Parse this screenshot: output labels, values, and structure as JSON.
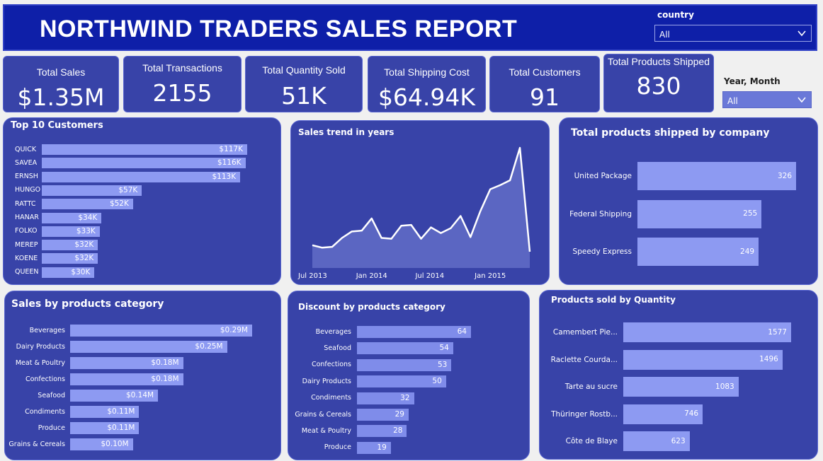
{
  "header": {
    "title": "NORTHWIND TRADERS SALES REPORT"
  },
  "slicers": {
    "country": {
      "label": "country",
      "value": "All"
    },
    "year_month": {
      "label": "Year, Month",
      "value": "All"
    }
  },
  "kpis": [
    {
      "label": "Total Sales",
      "value": "$1.35M"
    },
    {
      "label": "Total Transactions",
      "value": "2155"
    },
    {
      "label": "Total Quantity Sold",
      "value": "51K"
    },
    {
      "label": "Total Shipping Cost",
      "value": "$64.94K"
    },
    {
      "label": "Total Customers",
      "value": "91"
    },
    {
      "label": "Total Products Shipped",
      "value": "830"
    }
  ],
  "colors": {
    "panel": "#3843a8",
    "bar": "#8d9af2",
    "header": "#0e1fa8"
  },
  "chart_data": [
    {
      "type": "bar",
      "title": "Top 10 Customers",
      "categories": [
        "QUICK",
        "SAVEA",
        "ERNSH",
        "HUNGO",
        "RATTC",
        "HANAR",
        "FOLKO",
        "MEREP",
        "KOENE",
        "QUEEN"
      ],
      "values": [
        117,
        116,
        113,
        57,
        52,
        34,
        33,
        32,
        32,
        30
      ],
      "value_labels": [
        "$117K",
        "$116K",
        "$113K",
        "$57K",
        "$52K",
        "$34K",
        "$33K",
        "$32K",
        "$32K",
        "$30K"
      ]
    },
    {
      "type": "area",
      "title": "Sales trend in years",
      "x_ticks": [
        "Jul 2013",
        "Jan 2014",
        "Jul 2014",
        "Jan 2015"
      ],
      "x": [
        "2013-07",
        "2013-08",
        "2013-09",
        "2013-10",
        "2013-11",
        "2013-12",
        "2014-01",
        "2014-02",
        "2014-03",
        "2014-04",
        "2014-05",
        "2014-06",
        "2014-07",
        "2014-08",
        "2014-09",
        "2014-10",
        "2014-11",
        "2014-12",
        "2015-01",
        "2015-02",
        "2015-03",
        "2015-04",
        "2015-05"
      ],
      "values": [
        28,
        25,
        26,
        37,
        45,
        46,
        61,
        37,
        36,
        52,
        53,
        36,
        50,
        43,
        49,
        64,
        38,
        70,
        97,
        102,
        108,
        148,
        20
      ],
      "ylim": [
        0,
        155
      ]
    },
    {
      "type": "bar",
      "title": "Total products shipped by company",
      "categories": [
        "United Package",
        "Federal Shipping",
        "Speedy Express"
      ],
      "values": [
        326,
        255,
        249
      ]
    },
    {
      "type": "bar",
      "title": "Sales by products category",
      "categories": [
        "Beverages",
        "Dairy Products",
        "Meat & Poultry",
        "Confections",
        "Seafood",
        "Condiments",
        "Produce",
        "Grains & Cereals"
      ],
      "values": [
        0.29,
        0.25,
        0.18,
        0.18,
        0.14,
        0.11,
        0.11,
        0.1
      ],
      "value_labels": [
        "$0.29M",
        "$0.25M",
        "$0.18M",
        "$0.18M",
        "$0.14M",
        "$0.11M",
        "$0.11M",
        "$0.10M"
      ]
    },
    {
      "type": "bar",
      "title": "Discount by products category",
      "categories": [
        "Beverages",
        "Seafood",
        "Confections",
        "Dairy Products",
        "Condiments",
        "Grains & Cereals",
        "Meat & Poultry",
        "Produce"
      ],
      "values": [
        64,
        54,
        53,
        50,
        32,
        29,
        28,
        19
      ]
    },
    {
      "type": "bar",
      "title": "Products sold by Quantity",
      "categories": [
        "Camembert Pie...",
        "Raclette Courda...",
        "Tarte au sucre",
        "Thüringer Rostb...",
        "Côte de Blaye"
      ],
      "values": [
        1577,
        1496,
        1083,
        746,
        623
      ]
    }
  ]
}
